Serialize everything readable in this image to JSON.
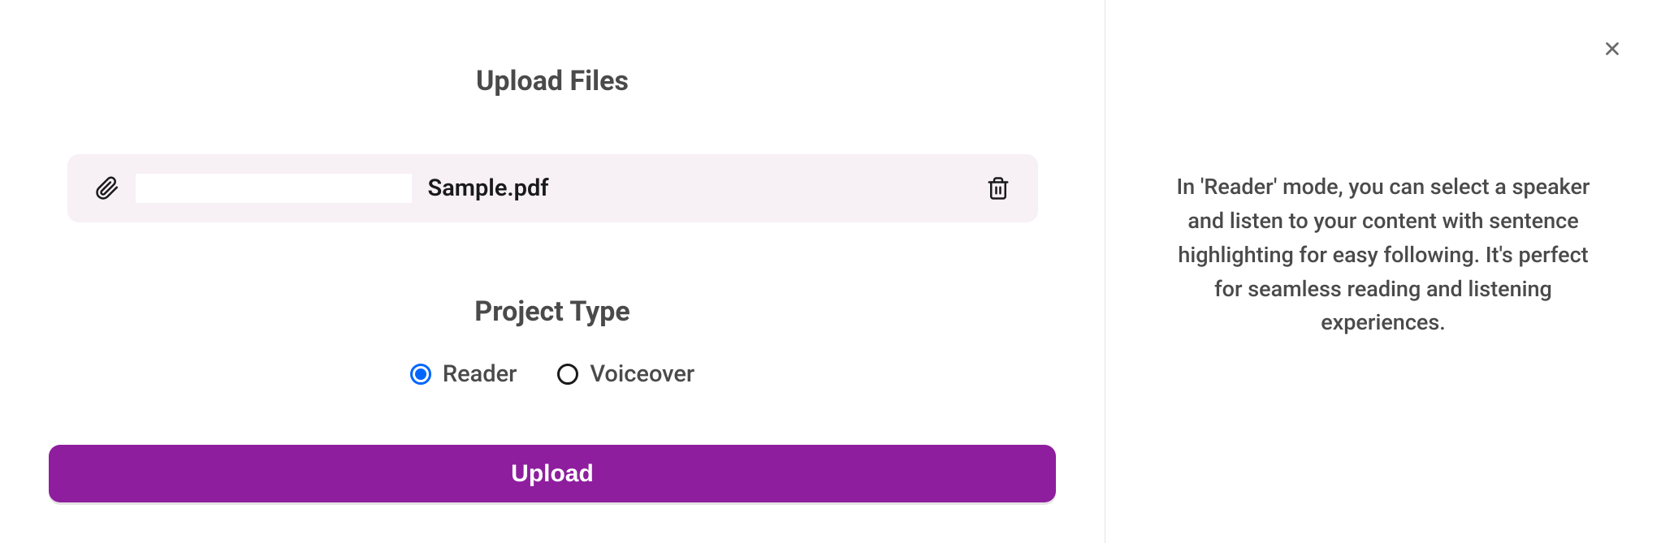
{
  "main": {
    "title": "Upload Files",
    "file": {
      "name": "Sample.pdf"
    },
    "projectType": {
      "title": "Project Type",
      "options": [
        {
          "label": "Reader",
          "selected": true
        },
        {
          "label": "Voiceover",
          "selected": false
        }
      ]
    },
    "uploadButton": "Upload"
  },
  "info": {
    "description": "In 'Reader' mode, you can select a speaker and listen to your content with sentence highlighting for easy following. It's perfect for seamless reading and listening experiences."
  }
}
